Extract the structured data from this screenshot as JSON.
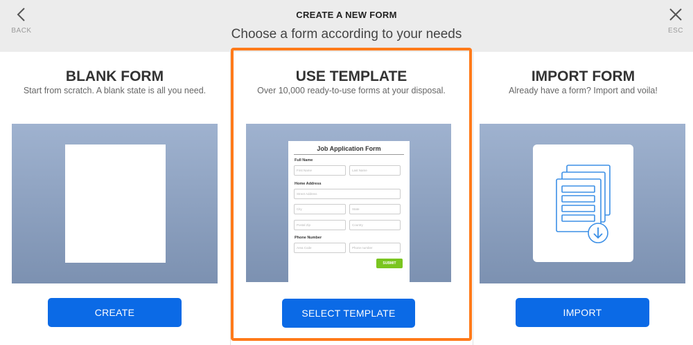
{
  "header": {
    "back_label": "BACK",
    "esc_label": "ESC",
    "title": "CREATE A NEW FORM",
    "subtitle": "Choose a form according to your needs"
  },
  "options": {
    "blank": {
      "title": "BLANK FORM",
      "description": "Start from scratch. A blank state is all you need.",
      "button": "CREATE"
    },
    "template": {
      "title": "USE TEMPLATE",
      "description": "Over 10,000 ready-to-use forms at your disposal.",
      "button": "SELECT TEMPLATE",
      "preview": {
        "form_title": "Job Application Form",
        "full_name_label": "Full Name",
        "first_name_placeholder": "First Name",
        "last_name_placeholder": "Last Name",
        "home_address_label": "Home Address",
        "street_placeholder": "Street Address",
        "city_placeholder": "City",
        "state_placeholder": "State",
        "postal_placeholder": "Postal Zip",
        "country_placeholder": "Country",
        "phone_label": "Phone Number",
        "area_code_placeholder": "Area Code",
        "phone_placeholder": "Phone number",
        "submit_label": "SUBMIT"
      }
    },
    "import": {
      "title": "IMPORT FORM",
      "description": "Already have a form? Import and voila!",
      "button": "IMPORT"
    }
  },
  "colors": {
    "accent_button": "#0b6ae6",
    "selection_border": "#ff7a1a",
    "header_bg": "#ececec",
    "submit_green": "#7ac520"
  },
  "icons": [
    "chevron-left-icon",
    "close-icon",
    "document-import-icon",
    "download-arrow-icon"
  ]
}
